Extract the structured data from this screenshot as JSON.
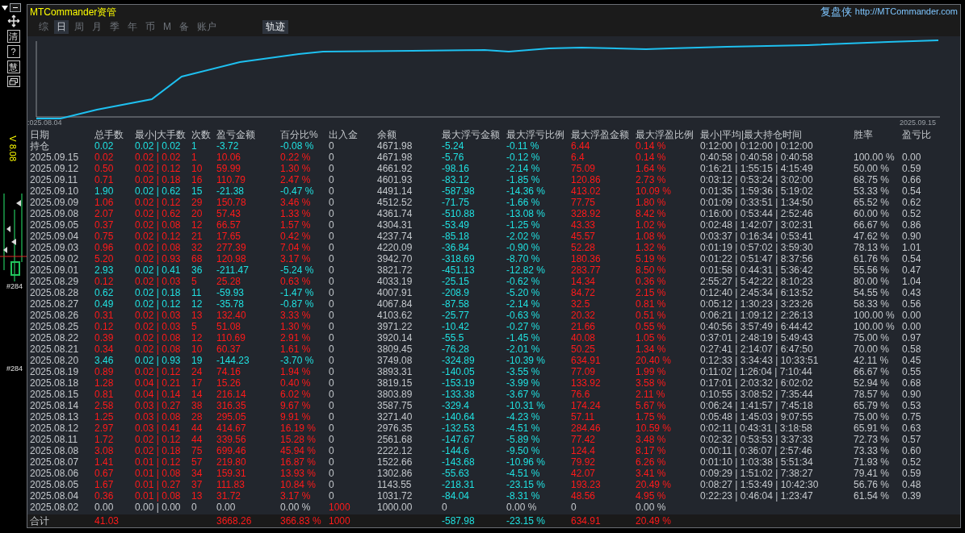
{
  "toolbar": {
    "items": [
      "清",
      "?",
      "慧"
    ]
  },
  "version": "V 8.08",
  "chart_marks": [
    "#284",
    "#284"
  ],
  "window": {
    "title": "MTCommander资管",
    "brand": "复盘侠",
    "link": "http://MTCommander.com"
  },
  "tabs": [
    {
      "label": "综",
      "selected": false
    },
    {
      "label": "日",
      "selected": true
    },
    {
      "label": "周",
      "selected": false
    },
    {
      "label": "月",
      "selected": false
    },
    {
      "label": "季",
      "selected": false
    },
    {
      "label": "年",
      "selected": false
    },
    {
      "label": "币",
      "selected": false
    },
    {
      "label": "M",
      "selected": false
    },
    {
      "label": "备",
      "selected": false
    },
    {
      "label": "账户",
      "selected": false
    }
  ],
  "view_toggle": {
    "label": "轨迹",
    "selected": true
  },
  "chart": {
    "start_label": ":025.08.04",
    "end_label": "2025.09.15"
  },
  "table": {
    "columns": [
      {
        "label": "日期",
        "kind": "plain"
      },
      {
        "label": "总手数",
        "kind": "row"
      },
      {
        "label": "最小|大手数",
        "kind": "row"
      },
      {
        "label": "次数",
        "kind": "row"
      },
      {
        "label": "盈亏金额",
        "kind": "row"
      },
      {
        "label": "百分比%",
        "kind": "row"
      },
      {
        "label": "出入金",
        "kind": "plain"
      },
      {
        "label": "余额",
        "kind": "plain"
      },
      {
        "label": "最大浮亏金额",
        "kind": "loss"
      },
      {
        "label": "最大浮亏比例",
        "kind": "loss"
      },
      {
        "label": "最大浮盈金额",
        "kind": "gain"
      },
      {
        "label": "最大浮盈比例",
        "kind": "gain"
      },
      {
        "label": "最小|平均|最大持仓时间",
        "kind": "plain"
      },
      {
        "label": "胜率",
        "kind": "plain"
      },
      {
        "label": "盈亏比",
        "kind": "plain"
      }
    ],
    "rows": [
      {
        "kind": "loss",
        "cells": [
          "持仓",
          "0.02",
          "0.02 | 0.02",
          "1",
          "-3.72",
          "-0.08 %",
          "0",
          "4671.98",
          "-5.24",
          "-0.11 %",
          "6.44",
          "0.14 %",
          "0:12:00 | 0:12:00 | 0:12:00",
          null,
          null
        ]
      },
      {
        "kind": "gain",
        "cells": [
          "2025.09.15",
          "0.02",
          "0.02 | 0.02",
          "1",
          "10.06",
          "0.22 %",
          "0",
          "4671.98",
          "-5.76",
          "-0.12 %",
          "6.4",
          "0.14 %",
          "0:40:58 | 0:40:58 | 0:40:58",
          "100.00 %",
          "0.00"
        ]
      },
      {
        "kind": "gain",
        "cells": [
          "2025.09.12",
          "0.50",
          "0.02 | 0.12",
          "10",
          "59.99",
          "1.30 %",
          "0",
          "4661.92",
          "-98.16",
          "-2.14 %",
          "75.09",
          "1.64 %",
          "0:16:21 | 1:55:15 | 4:15:49",
          "50.00 %",
          "0.59"
        ]
      },
      {
        "kind": "gain",
        "cells": [
          "2025.09.11",
          "0.71",
          "0.02 | 0.18",
          "16",
          "110.79",
          "2.47 %",
          "0",
          "4601.93",
          "-83.12",
          "-1.85 %",
          "120.86",
          "2.73 %",
          "0:03:12 | 0:53:24 | 3:02:00",
          "68.75 %",
          "0.66"
        ]
      },
      {
        "kind": "loss",
        "cells": [
          "2025.09.10",
          "1.90",
          "0.02 | 0.62",
          "15",
          "-21.38",
          "-0.47 %",
          "0",
          "4491.14",
          "-587.98",
          "-14.36 %",
          "413.02",
          "10.09 %",
          "0:01:35 | 1:59:36 | 5:19:02",
          "53.33 %",
          "0.54"
        ]
      },
      {
        "kind": "gain",
        "cells": [
          "2025.09.09",
          "1.06",
          "0.02 | 0.12",
          "29",
          "150.78",
          "3.46 %",
          "0",
          "4512.52",
          "-71.75",
          "-1.66 %",
          "77.75",
          "1.80 %",
          "0:01:09 | 0:33:51 | 1:34:50",
          "65.52 %",
          "0.62"
        ]
      },
      {
        "kind": "gain",
        "cells": [
          "2025.09.08",
          "2.07",
          "0.02 | 0.62",
          "20",
          "57.43",
          "1.33 %",
          "0",
          "4361.74",
          "-510.88",
          "-13.08 %",
          "328.92",
          "8.42 %",
          "0:16:00 | 0:53:44 | 2:52:46",
          "60.00 %",
          "0.52"
        ]
      },
      {
        "kind": "gain",
        "cells": [
          "2025.09.05",
          "0.37",
          "0.02 | 0.08",
          "12",
          "66.57",
          "1.57 %",
          "0",
          "4304.31",
          "-53.49",
          "-1.25 %",
          "43.33",
          "1.02 %",
          "0:02:48 | 1:42:07 | 3:02:31",
          "66.67 %",
          "0.86"
        ]
      },
      {
        "kind": "gain",
        "cells": [
          "2025.09.04",
          "0.75",
          "0.02 | 0.12",
          "21",
          "17.65",
          "0.42 %",
          "0",
          "4237.74",
          "-85.18",
          "-2.02 %",
          "45.57",
          "1.08 %",
          "0:03:37 | 0:16:34 | 0:53:41",
          "47.62 %",
          "0.90"
        ]
      },
      {
        "kind": "gain",
        "cells": [
          "2025.09.03",
          "0.96",
          "0.02 | 0.08",
          "32",
          "277.39",
          "7.04 %",
          "0",
          "4220.09",
          "-36.84",
          "-0.90 %",
          "52.28",
          "1.32 %",
          "0:01:19 | 0:57:02 | 3:59:30",
          "78.13 %",
          "1.01"
        ]
      },
      {
        "kind": "gain",
        "cells": [
          "2025.09.02",
          "5.20",
          "0.02 | 0.93",
          "68",
          "120.98",
          "3.17 %",
          "0",
          "3942.70",
          "-318.69",
          "-8.70 %",
          "180.36",
          "5.19 %",
          "0:01:22 | 0:51:47 | 8:37:56",
          "61.76 %",
          "0.54"
        ]
      },
      {
        "kind": "loss",
        "cells": [
          "2025.09.01",
          "2.93",
          "0.02 | 0.41",
          "36",
          "-211.47",
          "-5.24 %",
          "0",
          "3821.72",
          "-451.13",
          "-12.82 %",
          "283.77",
          "8.50 %",
          "0:01:58 | 0:44:31 | 5:36:42",
          "55.56 %",
          "0.47"
        ]
      },
      {
        "kind": "gain",
        "cells": [
          "2025.08.29",
          "0.12",
          "0.02 | 0.03",
          "5",
          "25.28",
          "0.63 %",
          "0",
          "4033.19",
          "-25.15",
          "-0.62 %",
          "14.34",
          "0.36 %",
          "2:55:27 | 5:42:22 | 8:10:23",
          "80.00 %",
          "1.04"
        ]
      },
      {
        "kind": "loss",
        "cells": [
          "2025.08.28",
          "0.62",
          "0.02 | 0.18",
          "11",
          "-59.93",
          "-1.47 %",
          "0",
          "4007.91",
          "-208.9",
          "-5.20 %",
          "84.72",
          "2.15 %",
          "0:12:40 | 2:45:34 | 6:13:52",
          "54.55 %",
          "0.43"
        ]
      },
      {
        "kind": "loss",
        "cells": [
          "2025.08.27",
          "0.49",
          "0.02 | 0.12",
          "12",
          "-35.78",
          "-0.87 %",
          "0",
          "4067.84",
          "-87.58",
          "-2.14 %",
          "32.5",
          "0.81 %",
          "0:05:12 | 1:30:23 | 3:23:26",
          "58.33 %",
          "0.56"
        ]
      },
      {
        "kind": "gain",
        "cells": [
          "2025.08.26",
          "0.31",
          "0.02 | 0.03",
          "13",
          "132.40",
          "3.33 %",
          "0",
          "4103.62",
          "-25.77",
          "-0.63 %",
          "20.32",
          "0.51 %",
          "0:06:21 | 1:09:12 | 2:26:13",
          "100.00 %",
          "0.00"
        ]
      },
      {
        "kind": "gain",
        "cells": [
          "2025.08.25",
          "0.12",
          "0.02 | 0.03",
          "5",
          "51.08",
          "1.30 %",
          "0",
          "3971.22",
          "-10.42",
          "-0.27 %",
          "21.66",
          "0.55 %",
          "0:40:56 | 3:57:49 | 6:44:42",
          "100.00 %",
          "0.00"
        ]
      },
      {
        "kind": "gain",
        "cells": [
          "2025.08.22",
          "0.39",
          "0.02 | 0.08",
          "12",
          "110.69",
          "2.91 %",
          "0",
          "3920.14",
          "-55.5",
          "-1.45 %",
          "40.08",
          "1.05 %",
          "0:37:01 | 2:48:19 | 5:49:43",
          "75.00 %",
          "0.97"
        ]
      },
      {
        "kind": "gain",
        "cells": [
          "2025.08.21",
          "0.34",
          "0.02 | 0.08",
          "10",
          "60.37",
          "1.61 %",
          "0",
          "3809.45",
          "-76.28",
          "-2.01 %",
          "50.25",
          "1.34 %",
          "0:27:41 | 2:14:07 | 6:47:50",
          "70.00 %",
          "0.58"
        ]
      },
      {
        "kind": "loss",
        "cells": [
          "2025.08.20",
          "3.46",
          "0.02 | 0.93",
          "19",
          "-144.23",
          "-3.70 %",
          "0",
          "3749.08",
          "-324.89",
          "-10.39 %",
          "634.91",
          "20.40 %",
          "0:12:33 | 3:34:43 | 10:33:51",
          "42.11 %",
          "0.45"
        ]
      },
      {
        "kind": "gain",
        "cells": [
          "2025.08.19",
          "0.89",
          "0.02 | 0.12",
          "24",
          "74.16",
          "1.94 %",
          "0",
          "3893.31",
          "-140.05",
          "-3.55 %",
          "77.09",
          "1.99 %",
          "0:11:02 | 1:26:04 | 7:10:44",
          "66.67 %",
          "0.55"
        ]
      },
      {
        "kind": "gain",
        "cells": [
          "2025.08.18",
          "1.28",
          "0.04 | 0.21",
          "17",
          "15.26",
          "0.40 %",
          "0",
          "3819.15",
          "-153.19",
          "-3.99 %",
          "133.92",
          "3.58 %",
          "0:17:01 | 2:03:32 | 6:02:02",
          "52.94 %",
          "0.68"
        ]
      },
      {
        "kind": "gain",
        "cells": [
          "2025.08.15",
          "0.81",
          "0.04 | 0.14",
          "14",
          "216.14",
          "6.02 %",
          "0",
          "3803.89",
          "-133.38",
          "-3.67 %",
          "76.6",
          "2.11 %",
          "0:10:55 | 3:08:52 | 7:35:44",
          "78.57 %",
          "0.90"
        ]
      },
      {
        "kind": "gain",
        "cells": [
          "2025.08.14",
          "2.58",
          "0.03 | 0.27",
          "38",
          "316.35",
          "9.67 %",
          "0",
          "3587.75",
          "-329.4",
          "-10.31 %",
          "174.24",
          "5.67 %",
          "0:06:24 | 1:41:57 | 7:45:18",
          "65.79 %",
          "0.53"
        ]
      },
      {
        "kind": "gain",
        "cells": [
          "2025.08.13",
          "1.25",
          "0.03 | 0.08",
          "28",
          "295.05",
          "9.91 %",
          "0",
          "3271.40",
          "-140.64",
          "-4.23 %",
          "57.11",
          "1.75 %",
          "0:05:48 | 1:45:03 | 9:07:55",
          "75.00 %",
          "0.75"
        ]
      },
      {
        "kind": "gain",
        "cells": [
          "2025.08.12",
          "2.97",
          "0.03 | 0.41",
          "44",
          "414.67",
          "16.19 %",
          "0",
          "2976.35",
          "-132.53",
          "-4.51 %",
          "284.46",
          "10.59 %",
          "0:02:11 | 0:43:31 | 3:18:58",
          "65.91 %",
          "0.63"
        ]
      },
      {
        "kind": "gain",
        "cells": [
          "2025.08.11",
          "1.72",
          "0.02 | 0.12",
          "44",
          "339.56",
          "15.28 %",
          "0",
          "2561.68",
          "-147.67",
          "-5.89 %",
          "77.42",
          "3.48 %",
          "0:02:32 | 0:53:53 | 3:37:33",
          "72.73 %",
          "0.57"
        ]
      },
      {
        "kind": "gain",
        "cells": [
          "2025.08.08",
          "3.08",
          "0.02 | 0.18",
          "75",
          "699.46",
          "45.94 %",
          "0",
          "2222.12",
          "-144.6",
          "-9.50 %",
          "124.4",
          "8.17 %",
          "0:00:11 | 0:36:07 | 2:57:46",
          "73.33 %",
          "0.60"
        ]
      },
      {
        "kind": "gain",
        "cells": [
          "2025.08.07",
          "1.41",
          "0.01 | 0.12",
          "57",
          "219.80",
          "16.87 %",
          "0",
          "1522.66",
          "-143.68",
          "-10.96 %",
          "79.92",
          "6.26 %",
          "0:01:10 | 1:03:38 | 5:51:34",
          "71.93 %",
          "0.52"
        ]
      },
      {
        "kind": "gain",
        "cells": [
          "2025.08.06",
          "0.67",
          "0.01 | 0.08",
          "34",
          "159.31",
          "13.93 %",
          "0",
          "1302.86",
          "-55.63",
          "-4.51 %",
          "42.07",
          "3.41 %",
          "0:09:29 | 1:51:02 | 7:38:27",
          "79.41 %",
          "0.59"
        ]
      },
      {
        "kind": "gain",
        "cells": [
          "2025.08.05",
          "1.67",
          "0.01 | 0.27",
          "37",
          "111.83",
          "10.84 %",
          "0",
          "1143.55",
          "-218.31",
          "-23.15 %",
          "193.23",
          "20.49 %",
          "0:08:27 | 1:53:49 | 10:42:30",
          "56.76 %",
          "0.48"
        ]
      },
      {
        "kind": "gain",
        "cells": [
          "2025.08.04",
          "0.36",
          "0.01 | 0.08",
          "13",
          "31.72",
          "3.17 %",
          "0",
          "1031.72",
          "-84.04",
          "-8.31 %",
          "48.56",
          "4.95 %",
          "0:22:23 | 0:46:04 | 1:23:47",
          "61.54 %",
          "0.39"
        ]
      },
      {
        "kind": "plain",
        "cells": [
          "2025.08.02",
          "0.00",
          "0.00 | 0.00",
          "0",
          "0.00",
          "0.00 %",
          {
            "text": "1000",
            "kind": "gain"
          },
          "1000.00",
          "0",
          "0.00 %",
          "0",
          "0.00 %",
          null,
          null,
          null
        ]
      }
    ],
    "total_row": {
      "kind": "gain",
      "cells": [
        {
          "text": "合计",
          "kind": "plain"
        },
        "41.03",
        null,
        null,
        "3668.26",
        "366.83 %",
        {
          "text": "1000",
          "kind": "gain"
        },
        null,
        "-587.98",
        "-23.15 %",
        "634.91",
        "20.49 %",
        null,
        null,
        null
      ]
    }
  }
}
